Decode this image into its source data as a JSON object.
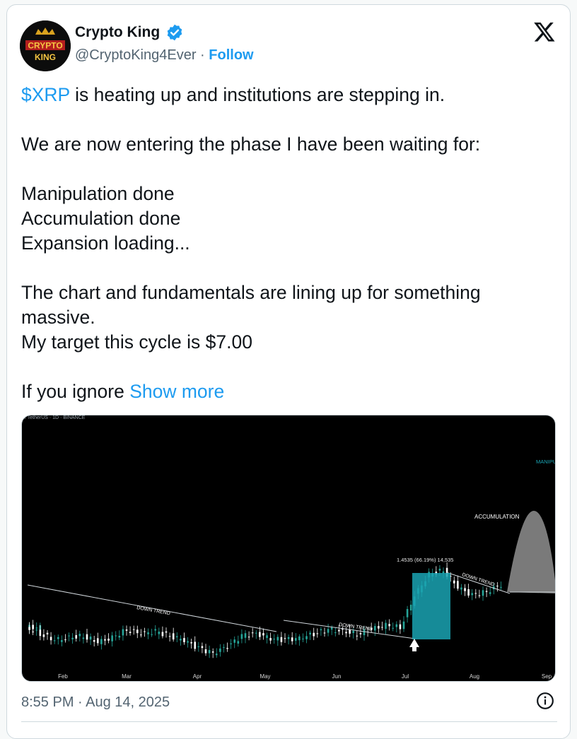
{
  "author": {
    "name": "Crypto King",
    "handle": "@CryptoKing4Ever",
    "separator": "·",
    "follow_label": "Follow",
    "avatar_text_top": "CRYPTO",
    "avatar_text_bottom": "KING",
    "verified_color": "#1d9bf0"
  },
  "tweet": {
    "line1_cashtag": "$XRP",
    "line1_rest": " is heating up and institutions are stepping in.",
    "line2": "We are now entering the phase I have been waiting for:",
    "line3": "Manipulation done",
    "line4": "Accumulation done",
    "line5": "Expansion loading...",
    "line6": "The chart and fundamentals are lining up for something",
    "line7": "massive.",
    "line8": "My target this cycle is $7.00",
    "line9_text": "If you ignore ",
    "show_more_label": "Show more"
  },
  "timestamp": "8:55 PM · Aug 14, 2025",
  "icons": {
    "platform_logo": "x-logo-icon",
    "verified": "verified-badge-icon",
    "info": "info-icon"
  },
  "colors": {
    "link": "#1d9bf0",
    "text": "#0f1419",
    "muted": "#536471",
    "candle_up": "#26a69a",
    "candle_down": "#ffffff",
    "highlight_box": "#1aa3b3"
  },
  "chart_data": {
    "type": "candlestick",
    "title_partial": "/ TetherUS · 1D · BINANCE",
    "x_tick_labels": [
      "Feb",
      "Mar",
      "Apr",
      "May",
      "Jun",
      "Jul",
      "Aug",
      "Sep"
    ],
    "annotations": {
      "trend_label": "DOWN TREND",
      "measure_label": "1.4535 (66.19%) 14,535",
      "accumulation_label": "ACCUMULATION",
      "manipulation_label_partial": "MANIPU"
    },
    "closes_approx": [
      2.25,
      2.1,
      1.95,
      2.0,
      2.05,
      1.9,
      2.0,
      2.2,
      2.1,
      2.15,
      2.05,
      1.95,
      1.75,
      1.65,
      1.8,
      2.05,
      2.1,
      2.0,
      1.95,
      2.0,
      2.1,
      2.2,
      2.15,
      2.1,
      2.2,
      2.3,
      2.25,
      3.0,
      3.5,
      3.6,
      3.2,
      3.0,
      3.1,
      3.25
    ]
  }
}
